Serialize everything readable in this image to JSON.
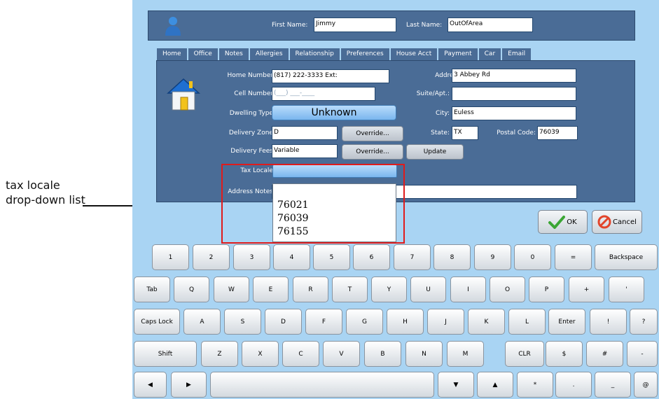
{
  "annotation": {
    "text": "tax locale drop-down list"
  },
  "header": {
    "first_name_label": "First Name:",
    "first_name_value": "Jimmy",
    "last_name_label": "Last Name:",
    "last_name_value": "OutOfArea"
  },
  "tabs": [
    "Home",
    "Office",
    "Notes",
    "Allergies",
    "Relationship",
    "Preferences",
    "House Acct",
    "Payment",
    "Car",
    "Email"
  ],
  "form": {
    "home_number_label": "Home Number:",
    "home_number_value": "(817) 222-3333 Ext:",
    "cell_number_label": "Cell Number:",
    "cell_number_value": "(___) ___-____",
    "dwelling_type_label": "Dwelling Type:",
    "dwelling_type_value": "Unknown",
    "delivery_zone_label": "Delivery Zone:",
    "delivery_zone_value": "D",
    "delivery_fees_label": "Delivery Fees:",
    "delivery_fees_value": "Variable",
    "override_label": "Override...",
    "update_label": "Update",
    "tax_locale_label": "Tax Locale:",
    "address_notes_label": "Address Notes:",
    "address_label": "Address:",
    "address_value": "3 Abbey Rd",
    "suite_label": "Suite/Apt.:",
    "suite_value": "",
    "city_label": "City:",
    "city_value": "Euless",
    "state_label": "State:",
    "state_value": "TX",
    "postal_code_label": "Postal Code:",
    "postal_code_value": "76039"
  },
  "tax_locale_options": [
    "76021",
    "76039",
    "76155"
  ],
  "actions": {
    "ok": "OK",
    "cancel": "Cancel"
  },
  "keyboard": {
    "row1": [
      "1",
      "2",
      "3",
      "4",
      "5",
      "6",
      "7",
      "8",
      "9",
      "0",
      "=",
      "Backspace"
    ],
    "row2": [
      "Tab",
      "Q",
      "W",
      "E",
      "R",
      "T",
      "Y",
      "U",
      "I",
      "O",
      "P",
      "+",
      "'"
    ],
    "row3": [
      "Caps Lock",
      "A",
      "S",
      "D",
      "F",
      "G",
      "H",
      "J",
      "K",
      "L",
      "Enter",
      "!",
      "?"
    ],
    "row4": [
      "Shift",
      "Z",
      "X",
      "C",
      "V",
      "B",
      "N",
      "M",
      "CLR",
      "$",
      "#",
      "-"
    ],
    "row5": [
      "◀",
      "▶",
      "",
      "▼",
      "▲",
      "*",
      ".",
      "_",
      "@"
    ]
  },
  "colors": {
    "background": "#a9d4f3",
    "panel": "#4a6c96",
    "highlight": "#e01b1b",
    "ok_check": "#3aa634",
    "cancel_icon": "#e2452b"
  }
}
